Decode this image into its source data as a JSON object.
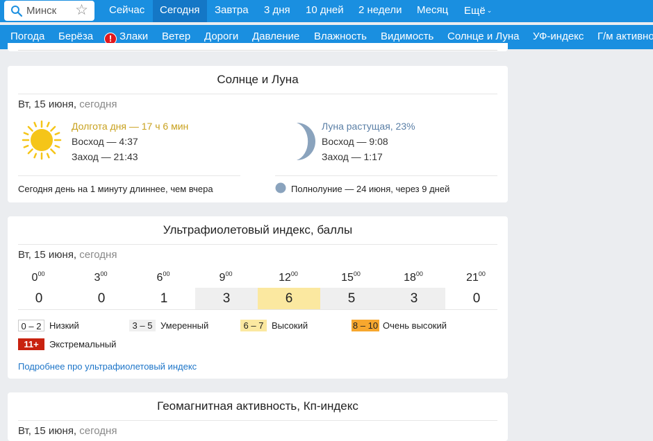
{
  "search": {
    "value": "Минск"
  },
  "tabs": [
    {
      "label": "Сейчас"
    },
    {
      "label": "Сегодня"
    },
    {
      "label": "Завтра"
    },
    {
      "label": "3 дня"
    },
    {
      "label": "10 дней"
    },
    {
      "label": "2 недели"
    },
    {
      "label": "Месяц"
    },
    {
      "label": "Ещё"
    }
  ],
  "subnav": [
    {
      "label": "Погода"
    },
    {
      "label": "Берёза"
    },
    {
      "label": "Злаки"
    },
    {
      "label": "Ветер"
    },
    {
      "label": "Дороги"
    },
    {
      "label": "Давление"
    },
    {
      "label": "Влажность"
    },
    {
      "label": "Видимость"
    },
    {
      "label": "Солнце и Луна"
    },
    {
      "label": "УФ-индекс"
    },
    {
      "label": "Г/м активность"
    }
  ],
  "sunmoon": {
    "title": "Солнце и Луна",
    "date": "Вт, 15 июня,",
    "date_muted": "сегодня",
    "day_length": "Долгота дня — 17 ч 6 мин",
    "sunrise": "Восход — 4:37",
    "sunset": "Заход — 21:43",
    "day_note": "Сегодня день на 1 минуту длиннее, чем вчера",
    "moon_phase": "Луна растущая, 23%",
    "moonrise": "Восход — 9:08",
    "moonset": "Заход — 1:17",
    "full_moon": "Полнолуние — 24 июня, через 9 дней",
    "colors": {
      "sun": "#f5c518",
      "day_length_text": "#c8a11d",
      "moon": "#8aa3bd",
      "moon_text": "#5a7fa6"
    }
  },
  "uv": {
    "title": "Ультрафиолетовый индекс, баллы",
    "date": "Вт, 15 июня,",
    "date_muted": "сегодня",
    "hours": [
      {
        "h": "0",
        "m": "00",
        "value": "0",
        "level": "low"
      },
      {
        "h": "3",
        "m": "00",
        "value": "0",
        "level": "low"
      },
      {
        "h": "6",
        "m": "00",
        "value": "1",
        "level": "low"
      },
      {
        "h": "9",
        "m": "00",
        "value": "3",
        "level": "moderate"
      },
      {
        "h": "12",
        "m": "00",
        "value": "6",
        "level": "high"
      },
      {
        "h": "15",
        "m": "00",
        "value": "5",
        "level": "moderate"
      },
      {
        "h": "18",
        "m": "00",
        "value": "3",
        "level": "moderate"
      },
      {
        "h": "21",
        "m": "00",
        "value": "0",
        "level": "low"
      }
    ],
    "legend": [
      {
        "range": "0 – 2",
        "label": "Низкий",
        "color": "#ffffff",
        "text": "#222"
      },
      {
        "range": "3 – 5",
        "label": "Умеренный",
        "color": "#efefef",
        "text": "#222"
      },
      {
        "range": "6 – 7",
        "label": "Высокий",
        "color": "#fbe8a0",
        "text": "#222"
      },
      {
        "range": "8 – 10",
        "label": "Очень высокий",
        "color": "#f7a72e",
        "text": "#222"
      },
      {
        "range": "11+",
        "label": "Экстремальный",
        "color": "#c8220f",
        "text": "#ffffff"
      }
    ],
    "more_link": "Подробнее про ультрафиолетовый индекс"
  },
  "geo": {
    "title": "Геомагнитная активность, Кп-индекс",
    "date": "Вт, 15 июня,",
    "date_muted": "сегодня"
  }
}
